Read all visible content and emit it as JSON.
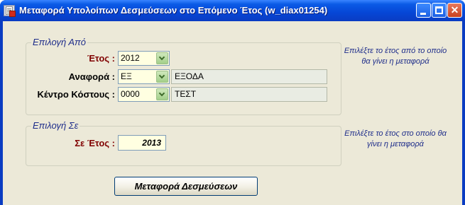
{
  "window": {
    "title": "Μεταφορά Υπολοίπων Δεσμεύσεων στο Επόμενο Έτος   (w_diax01254)",
    "icon": "document-app-icon",
    "controls": [
      "minimize-icon",
      "maximize-icon",
      "close-icon"
    ],
    "close_glyph": "✕"
  },
  "from_group": {
    "title": "Επιλογή Από",
    "year_label": "Έτος :",
    "year_value": "2012",
    "reference_label": "Αναφορά :",
    "reference_code": "ΕΞ",
    "reference_desc": "ΕΞΟΔΑ",
    "cost_center_label": "Κέντρο Κόστους :",
    "cost_center_code": "0000",
    "cost_center_desc": "ΤΕΣΤ",
    "hint": "Επιλέξτε το έτος από το οποίο θα γίνει η μεταφορά"
  },
  "to_group": {
    "title": "Επιλογή Σε",
    "year_label": "Σε Έτος :",
    "year_value": "2013",
    "hint": "Επιλέξτε το έτος στο οποίο θα γίνει η μεταφορά"
  },
  "actions": {
    "transfer_label": "Μεταφορά Δεσμεύσεων"
  },
  "colors": {
    "titlebar": "#0a5ae6",
    "client_bg": "#ece9d8",
    "input_bg": "#ffffe1",
    "hint_text": "#1e2d8a",
    "label_red": "#800000"
  }
}
